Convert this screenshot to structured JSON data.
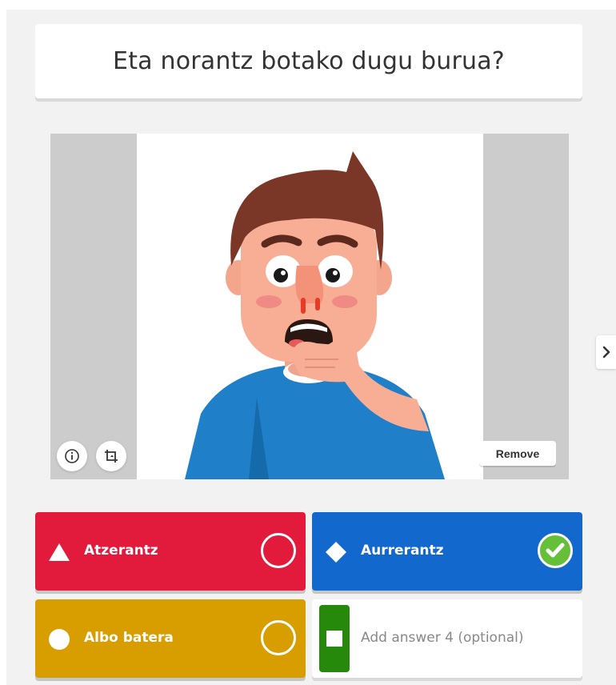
{
  "question": {
    "title": "Eta norantz botako dugu burua?"
  },
  "media": {
    "remove_label": "Remove",
    "info_icon": "info-icon",
    "crop_icon": "crop-icon"
  },
  "navigation": {
    "next_icon": "chevron-right-icon"
  },
  "answers": [
    {
      "label": "Atzerantz",
      "shape": "triangle",
      "color": "#e21b3c",
      "correct": false
    },
    {
      "label": "Aurrerantz",
      "shape": "diamond",
      "color": "#1368ce",
      "correct": true
    },
    {
      "label": "Albo batera",
      "shape": "circle",
      "color": "#d89e00",
      "correct": false
    },
    {
      "placeholder": "Add answer 4 (optional)",
      "shape": "square",
      "color": "#26890c"
    }
  ],
  "colors": {
    "correct_check": "#66bf39"
  }
}
